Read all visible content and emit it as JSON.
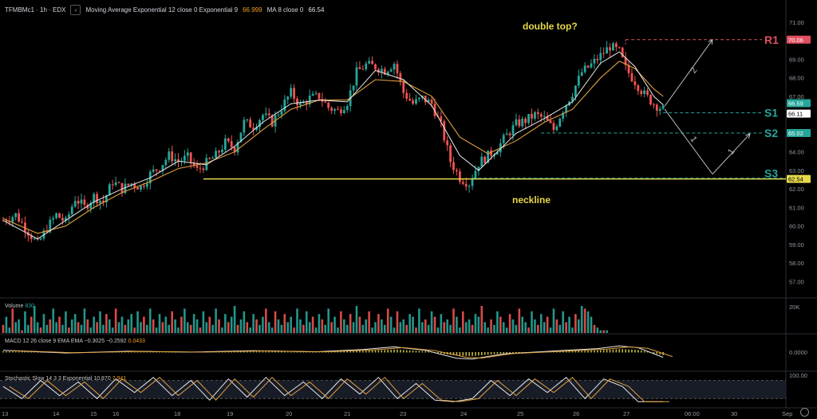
{
  "header": {
    "symbol": "TFMBMc1 · 1h · EDX",
    "ind1_label": "Moving Average Exponential 12 close 0 Exponential 9",
    "ind1_value": "66.999",
    "ind2_label": "MA 8 close 0",
    "ind2_value": "66.54"
  },
  "panes": {
    "volume": {
      "label": "Volume",
      "value": "830",
      "scale": "20K"
    },
    "macd": {
      "label": "MACD 12 26 close 9 EMA EMA",
      "v1": "−0.3025",
      "v2": "−0.2592",
      "v3": "0.0433",
      "scale": "0.0000"
    },
    "stoch": {
      "label": "Stochastic Slow 14 3 3 Exponential",
      "v1": "10.870",
      "v2": "7.941",
      "scale": "100.00"
    }
  },
  "annotations": {
    "double_top": "double top?",
    "neckline": "neckline",
    "r1": "R1",
    "s1": "S1",
    "s2": "S2",
    "s3": "S3",
    "wave2": "2",
    "wave1a": "1",
    "wave1b": "1"
  },
  "price_badges": [
    {
      "value": "70.06",
      "price": 70.06,
      "color": "#e05060"
    },
    {
      "value": "66.59",
      "price": 66.59,
      "color": "#26a69a"
    },
    {
      "value": "66.11",
      "price": 66.11,
      "color": "#ffffff"
    },
    {
      "value": "65.02",
      "price": 65.02,
      "color": "#26a69a"
    },
    {
      "value": "62.54",
      "price": 62.54,
      "color": "#e6d84a"
    }
  ],
  "colors": {
    "up": "#26a69a",
    "down": "#ef5350",
    "ema12": "#e0a040",
    "ma8": "#e8e8e8",
    "neckline": "#e6d84a",
    "resist": "#e05060",
    "support": "#26a69a"
  },
  "chart_data": {
    "type": "candlestick",
    "title": "TFMBMc1 · 1h · EDX",
    "y_axis_ticks": [
      "71.00",
      "70.00",
      "69.00",
      "68.00",
      "67.00",
      "66.00",
      "65.00",
      "64.00",
      "63.00",
      "62.00",
      "61.00",
      "60.00",
      "59.00",
      "58.00",
      "57.00"
    ],
    "ylim": [
      56.2,
      71.6
    ],
    "x_axis_labels": [
      "13",
      "14",
      "15",
      "16",
      "18",
      "19",
      "20",
      "21",
      "23",
      "24",
      "25",
      "26",
      "27",
      "06:00",
      "30",
      "Sep"
    ],
    "levels": {
      "R1": 70.06,
      "S1": 66.11,
      "S2": 65.02,
      "S3": 62.54,
      "neckline": 62.54
    },
    "close_path": [
      [
        0,
        60.3
      ],
      [
        4,
        60.6
      ],
      [
        8,
        59.7
      ],
      [
        11,
        59.0
      ],
      [
        14,
        59.9
      ],
      [
        17,
        60.6
      ],
      [
        20,
        60.2
      ],
      [
        23,
        61.5
      ],
      [
        26,
        61.0
      ],
      [
        29,
        61.6
      ],
      [
        32,
        61.3
      ],
      [
        35,
        62.4
      ],
      [
        38,
        62.0
      ],
      [
        41,
        62.3
      ],
      [
        44,
        62.1
      ],
      [
        47,
        62.8
      ],
      [
        50,
        63.2
      ],
      [
        53,
        63.8
      ],
      [
        56,
        63.5
      ],
      [
        59,
        63.7
      ],
      [
        62,
        63.0
      ],
      [
        65,
        63.4
      ],
      [
        68,
        63.8
      ],
      [
        71,
        64.5
      ],
      [
        74,
        64.2
      ],
      [
        77,
        65.6
      ],
      [
        80,
        65.4
      ],
      [
        83,
        66.0
      ],
      [
        86,
        65.6
      ],
      [
        89,
        66.4
      ],
      [
        92,
        67.2
      ],
      [
        95,
        66.5
      ],
      [
        98,
        66.9
      ],
      [
        101,
        67.0
      ],
      [
        104,
        66.4
      ],
      [
        107,
        66.2
      ],
      [
        110,
        66.7
      ],
      [
        113,
        68.3
      ],
      [
        116,
        68.7
      ],
      [
        119,
        68.6
      ],
      [
        122,
        68.4
      ],
      [
        125,
        68.8
      ],
      [
        128,
        67.2
      ],
      [
        131,
        66.6
      ],
      [
        134,
        66.9
      ],
      [
        137,
        66.6
      ],
      [
        140,
        65.4
      ],
      [
        143,
        63.5
      ],
      [
        146,
        62.6
      ],
      [
        149,
        62.3
      ],
      [
        152,
        63.4
      ],
      [
        155,
        63.8
      ],
      [
        158,
        64.2
      ],
      [
        161,
        64.9
      ],
      [
        164,
        65.5
      ],
      [
        167,
        65.7
      ],
      [
        170,
        66.0
      ],
      [
        173,
        65.8
      ],
      [
        176,
        65.2
      ],
      [
        179,
        66.3
      ],
      [
        182,
        67.2
      ],
      [
        185,
        68.3
      ],
      [
        188,
        68.7
      ],
      [
        191,
        69.2
      ],
      [
        194,
        69.7
      ],
      [
        197,
        69.4
      ],
      [
        199,
        68.5
      ],
      [
        202,
        67.8
      ],
      [
        205,
        67.1
      ],
      [
        208,
        66.6
      ],
      [
        211,
        66.3
      ]
    ],
    "ema12_path": [
      [
        0,
        60.4
      ],
      [
        11,
        59.6
      ],
      [
        20,
        60.0
      ],
      [
        29,
        61.0
      ],
      [
        38,
        61.8
      ],
      [
        47,
        62.4
      ],
      [
        56,
        63.1
      ],
      [
        65,
        63.4
      ],
      [
        74,
        64.0
      ],
      [
        83,
        65.2
      ],
      [
        92,
        66.3
      ],
      [
        101,
        66.8
      ],
      [
        110,
        66.8
      ],
      [
        119,
        67.9
      ],
      [
        128,
        67.8
      ],
      [
        137,
        67.0
      ],
      [
        146,
        64.8
      ],
      [
        155,
        63.9
      ],
      [
        164,
        64.6
      ],
      [
        173,
        65.6
      ],
      [
        182,
        66.3
      ],
      [
        191,
        68.0
      ],
      [
        197,
        68.9
      ],
      [
        202,
        68.5
      ],
      [
        208,
        67.4
      ],
      [
        211,
        66.999
      ]
    ],
    "ma8_path": [
      [
        0,
        60.3
      ],
      [
        11,
        59.3
      ],
      [
        20,
        60.3
      ],
      [
        29,
        61.3
      ],
      [
        38,
        62.0
      ],
      [
        47,
        62.6
      ],
      [
        56,
        63.5
      ],
      [
        65,
        63.3
      ],
      [
        74,
        64.3
      ],
      [
        83,
        65.6
      ],
      [
        92,
        66.6
      ],
      [
        101,
        66.8
      ],
      [
        110,
        66.7
      ],
      [
        119,
        68.4
      ],
      [
        128,
        67.9
      ],
      [
        137,
        66.5
      ],
      [
        146,
        63.8
      ],
      [
        152,
        63.0
      ],
      [
        164,
        65.0
      ],
      [
        173,
        65.8
      ],
      [
        182,
        66.7
      ],
      [
        191,
        68.8
      ],
      [
        197,
        69.4
      ],
      [
        202,
        68.6
      ],
      [
        208,
        67.0
      ],
      [
        211,
        66.54
      ]
    ],
    "volume_bars": [
      3,
      6,
      2,
      9,
      4,
      5,
      1,
      8,
      3,
      6,
      10,
      4,
      2,
      7,
      3,
      5,
      9,
      4,
      6,
      3,
      8,
      2,
      5,
      7,
      4,
      3,
      9,
      5,
      2,
      6,
      4,
      8,
      3,
      7,
      5,
      2,
      9,
      4,
      6,
      3,
      5,
      7,
      2,
      8,
      4,
      6,
      3,
      9,
      5,
      2,
      7,
      4,
      6,
      3,
      8,
      5,
      2,
      6,
      9,
      4,
      3,
      7,
      5,
      2,
      8,
      4,
      6,
      3,
      9,
      5,
      2,
      7,
      4,
      6,
      10,
      3,
      5,
      8,
      4,
      2,
      7,
      5,
      3,
      6,
      9,
      4,
      2,
      8,
      5,
      3,
      7,
      4,
      6,
      2,
      9,
      5,
      3,
      8,
      4,
      6,
      2,
      7,
      5,
      3,
      9,
      4,
      6,
      2,
      8,
      5,
      3,
      7,
      4,
      10,
      6,
      3,
      5,
      8,
      2,
      4,
      7,
      5,
      3,
      9,
      6,
      2,
      8,
      4,
      5,
      3,
      7,
      6,
      2,
      9,
      4,
      5,
      3,
      8,
      6,
      2,
      7,
      4,
      5,
      3,
      9,
      6,
      2,
      8,
      4,
      5,
      3,
      7,
      6,
      10,
      4,
      2,
      5,
      3,
      8,
      6,
      4,
      2,
      7,
      5,
      3,
      9,
      6,
      4,
      2,
      8,
      5,
      3,
      7,
      4,
      6,
      2,
      9,
      5,
      3,
      8,
      4,
      6,
      2,
      7,
      5,
      10,
      9,
      8,
      6,
      3,
      2,
      1,
      1,
      1
    ],
    "macd_path": [
      [
        0,
        0.1
      ],
      [
        20,
        -0.05
      ],
      [
        40,
        0.05
      ],
      [
        60,
        0.0
      ],
      [
        80,
        0.08
      ],
      [
        100,
        0.02
      ],
      [
        115,
        0.15
      ],
      [
        125,
        0.3
      ],
      [
        135,
        0.1
      ],
      [
        145,
        -0.35
      ],
      [
        150,
        -0.4
      ],
      [
        160,
        -0.1
      ],
      [
        170,
        0.0
      ],
      [
        180,
        0.1
      ],
      [
        190,
        0.2
      ],
      [
        197,
        0.35
      ],
      [
        203,
        0.25
      ],
      [
        211,
        -0.3
      ]
    ],
    "stoch_path": [
      [
        0,
        60
      ],
      [
        6,
        20
      ],
      [
        12,
        80
      ],
      [
        18,
        30
      ],
      [
        24,
        75
      ],
      [
        30,
        20
      ],
      [
        36,
        85
      ],
      [
        42,
        40
      ],
      [
        48,
        90
      ],
      [
        54,
        30
      ],
      [
        60,
        80
      ],
      [
        66,
        15
      ],
      [
        72,
        85
      ],
      [
        78,
        25
      ],
      [
        84,
        90
      ],
      [
        90,
        30
      ],
      [
        96,
        75
      ],
      [
        102,
        20
      ],
      [
        108,
        85
      ],
      [
        114,
        35
      ],
      [
        120,
        90
      ],
      [
        126,
        20
      ],
      [
        132,
        70
      ],
      [
        138,
        15
      ],
      [
        144,
        10
      ],
      [
        150,
        20
      ],
      [
        156,
        80
      ],
      [
        162,
        30
      ],
      [
        168,
        85
      ],
      [
        174,
        40
      ],
      [
        180,
        90
      ],
      [
        186,
        20
      ],
      [
        192,
        85
      ],
      [
        198,
        60
      ],
      [
        203,
        10
      ],
      [
        211,
        10
      ]
    ]
  }
}
